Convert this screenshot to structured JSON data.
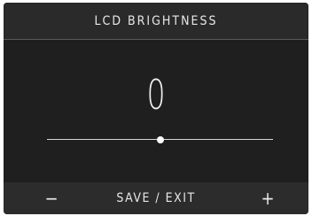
{
  "header": {
    "title": "LCD BRIGHTNESS"
  },
  "brightness": {
    "display_value": "0",
    "level": 0.5
  },
  "footer": {
    "minus_label": "−",
    "save_label": "SAVE / EXIT",
    "plus_label": "+"
  },
  "colors": {
    "background": "#1f1f1f",
    "text": "#e6e6e6",
    "track": "#d8d8d8",
    "thumb": "#ffffff"
  }
}
